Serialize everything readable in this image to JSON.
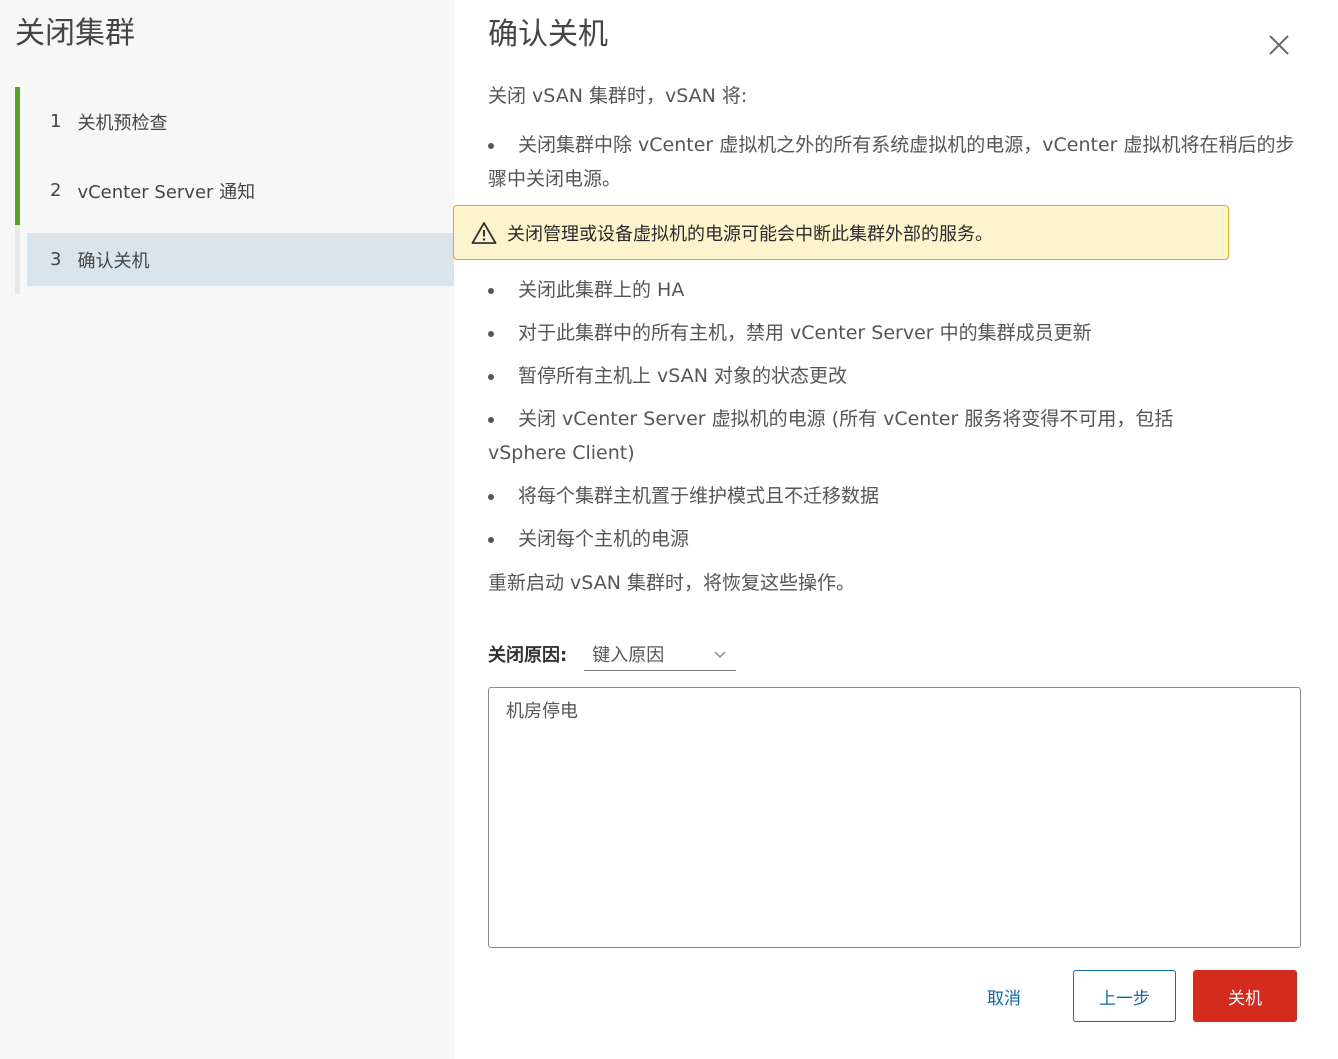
{
  "wizard": {
    "title": "关闭集群",
    "steps": [
      {
        "num": "1",
        "label": "关机预检查",
        "state": "done"
      },
      {
        "num": "2",
        "label": "vCenter Server 通知",
        "state": "done"
      },
      {
        "num": "3",
        "label": "确认关机",
        "state": "active"
      }
    ]
  },
  "dialog": {
    "title": "确认关机",
    "close_icon": "close-icon",
    "intro": "关闭 vSAN 集群时，vSAN 将:",
    "actions": [
      "关闭集群中除 vCenter 虚拟机之外的所有系统虚拟机的电源，vCenter 虚拟机将在稍后的步骤中关闭电源。",
      "关闭此集群上的 HA",
      "对于此集群中的所有主机，禁用 vCenter Server 中的集群成员更新",
      "暂停所有主机上 vSAN 对象的状态更改",
      "关闭 vCenter Server 虚拟机的电源 (所有 vCenter 服务将变得不可用，包括 vSphere Client)",
      "将每个集群主机置于维护模式且不迁移数据",
      "关闭每个主机的电源"
    ],
    "warning": {
      "icon": "warning-triangle-icon",
      "text": "关闭管理或设备虚拟机的电源可能会中断此集群外部的服务。",
      "color": "#e0a91b"
    },
    "outro": "重新启动 vSAN 集群时，将恢复这些操作。",
    "reason": {
      "label": "关闭原因:",
      "select_value": "键入原因",
      "text_value": "机房停电"
    },
    "buttons": {
      "cancel": "取消",
      "back": "上一步",
      "shutdown": "关机"
    }
  },
  "colors": {
    "accent": "#0f6aa6",
    "danger": "#d52b1e",
    "step_done": "#5aa220",
    "step_active_bg": "#d9e4ec"
  }
}
